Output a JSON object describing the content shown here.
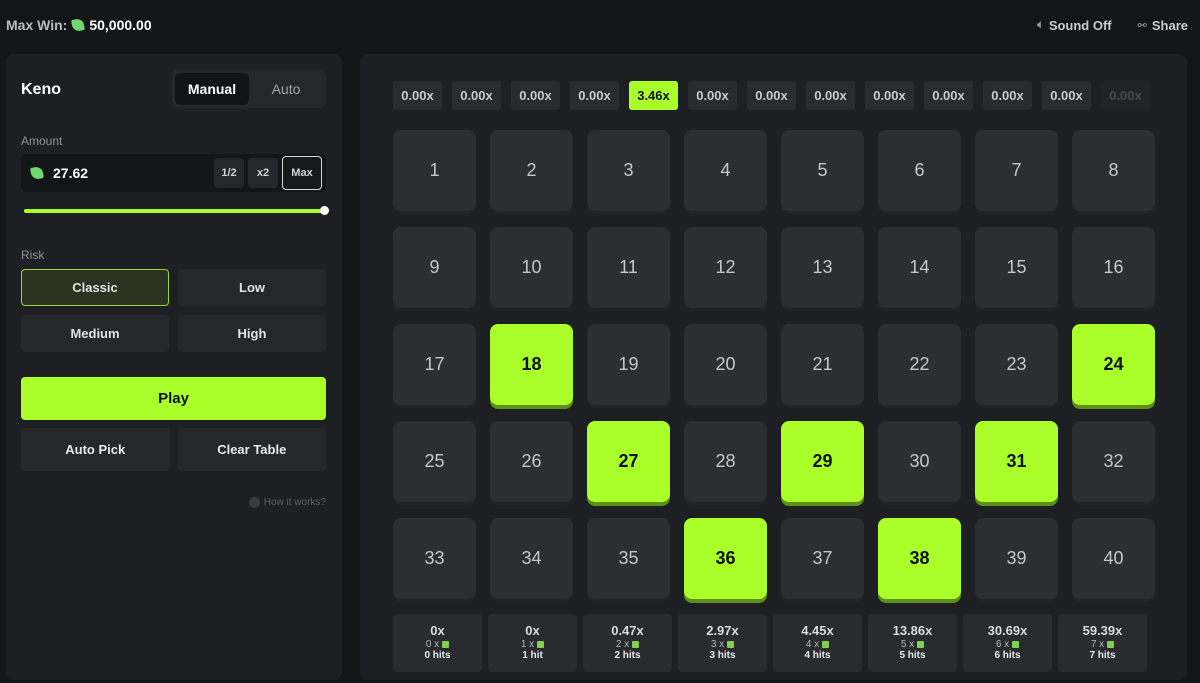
{
  "topbar": {
    "max_win_label": "Max Win:",
    "max_win_value": "50,000.00",
    "sound_label": "Sound Off",
    "share_label": "Share"
  },
  "panel": {
    "title": "Keno",
    "modes": [
      "Manual",
      "Auto"
    ],
    "active_mode": "Manual",
    "amount_label": "Amount",
    "amount_value": "27.62",
    "half_label": "1/2",
    "double_label": "x2",
    "max_label": "Max",
    "slider_level": 1.0,
    "risk_label": "Risk",
    "risk_options": [
      "Classic",
      "Low",
      "Medium",
      "High"
    ],
    "selected_risk": "Classic",
    "play_label": "Play",
    "auto_pick_label": "Auto Pick",
    "clear_label": "Clear Table",
    "how_label": "How it works?"
  },
  "multipliers": [
    "0.00x",
    "0.00x",
    "0.00x",
    "0.00x",
    "3.46x",
    "0.00x",
    "0.00x",
    "0.00x",
    "0.00x",
    "0.00x",
    "0.00x",
    "0.00x",
    "0.00x"
  ],
  "active_multiplier_index": 4,
  "board": {
    "numbers": [
      1,
      2,
      3,
      4,
      5,
      6,
      7,
      8,
      9,
      10,
      11,
      12,
      13,
      14,
      15,
      16,
      17,
      18,
      19,
      20,
      21,
      22,
      23,
      24,
      25,
      26,
      27,
      28,
      29,
      30,
      31,
      32,
      33,
      34,
      35,
      36,
      37,
      38,
      39,
      40
    ],
    "picked": [
      18,
      24,
      27,
      29,
      31,
      36,
      38
    ]
  },
  "payouts": [
    {
      "multiplier": "0x",
      "count": "0 x",
      "hits": "0 hits"
    },
    {
      "multiplier": "0x",
      "count": "1 x",
      "hits": "1 hit"
    },
    {
      "multiplier": "0.47x",
      "count": "2 x",
      "hits": "2 hits"
    },
    {
      "multiplier": "2.97x",
      "count": "3 x",
      "hits": "3 hits"
    },
    {
      "multiplier": "4.45x",
      "count": "4 x",
      "hits": "4 hits"
    },
    {
      "multiplier": "13.86x",
      "count": "5 x",
      "hits": "5 hits"
    },
    {
      "multiplier": "30.69x",
      "count": "6 x",
      "hits": "6 hits"
    },
    {
      "multiplier": "59.39x",
      "count": "7 x",
      "hits": "7 hits"
    }
  ],
  "colors": {
    "accent": "#aaff2b",
    "panel": "#1e1f22",
    "tile": "#2d2e32",
    "background": "#141517"
  }
}
